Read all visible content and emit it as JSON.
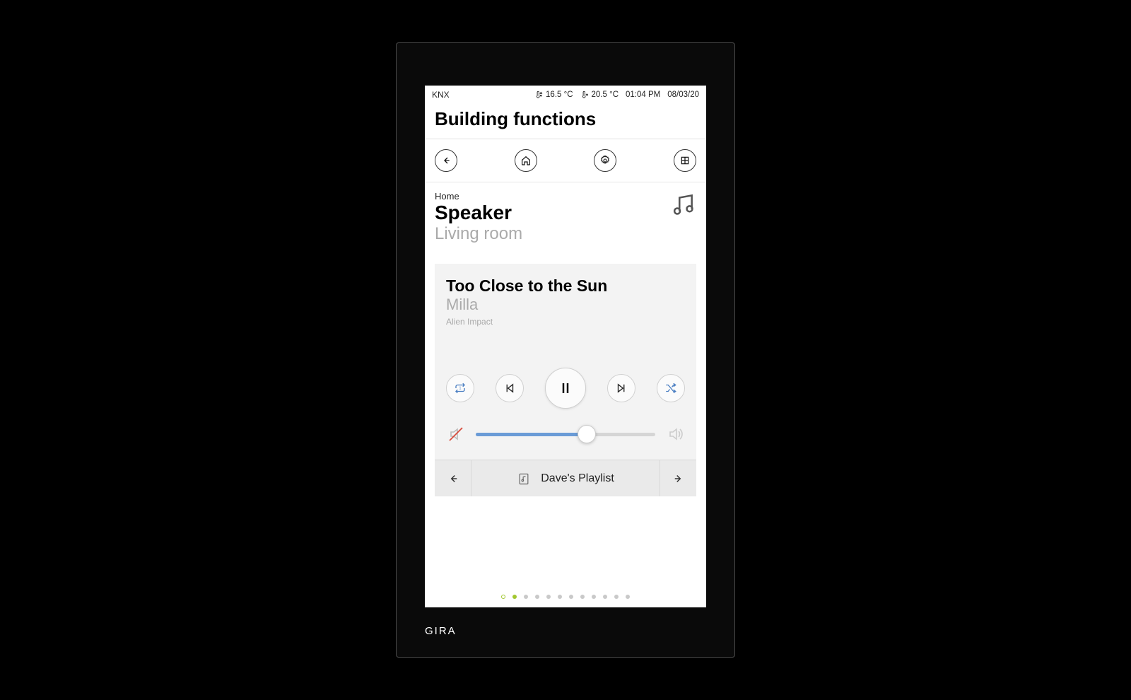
{
  "brand": "GIRA",
  "status": {
    "system": "KNX",
    "temp_outdoor": "16.5 °C",
    "temp_indoor": "20.5 °C",
    "time": "01:04 PM",
    "date": "08/03/20"
  },
  "page": {
    "title": "Building functions"
  },
  "header": {
    "crumb": "Home",
    "title": "Speaker",
    "subtitle": "Living room"
  },
  "player": {
    "track_title": "Too Close to the Sun",
    "artist": "Milla",
    "album": "Alien Impact",
    "volume_percent": 62,
    "playlist_label": "Dave's Playlist",
    "repeat_mode": "1"
  },
  "colors": {
    "accent_blue": "#6a9bd6",
    "accent_green": "#a2c72f",
    "muted_red": "#d84a3a"
  },
  "pager": {
    "count": 12,
    "active_index": 1
  }
}
